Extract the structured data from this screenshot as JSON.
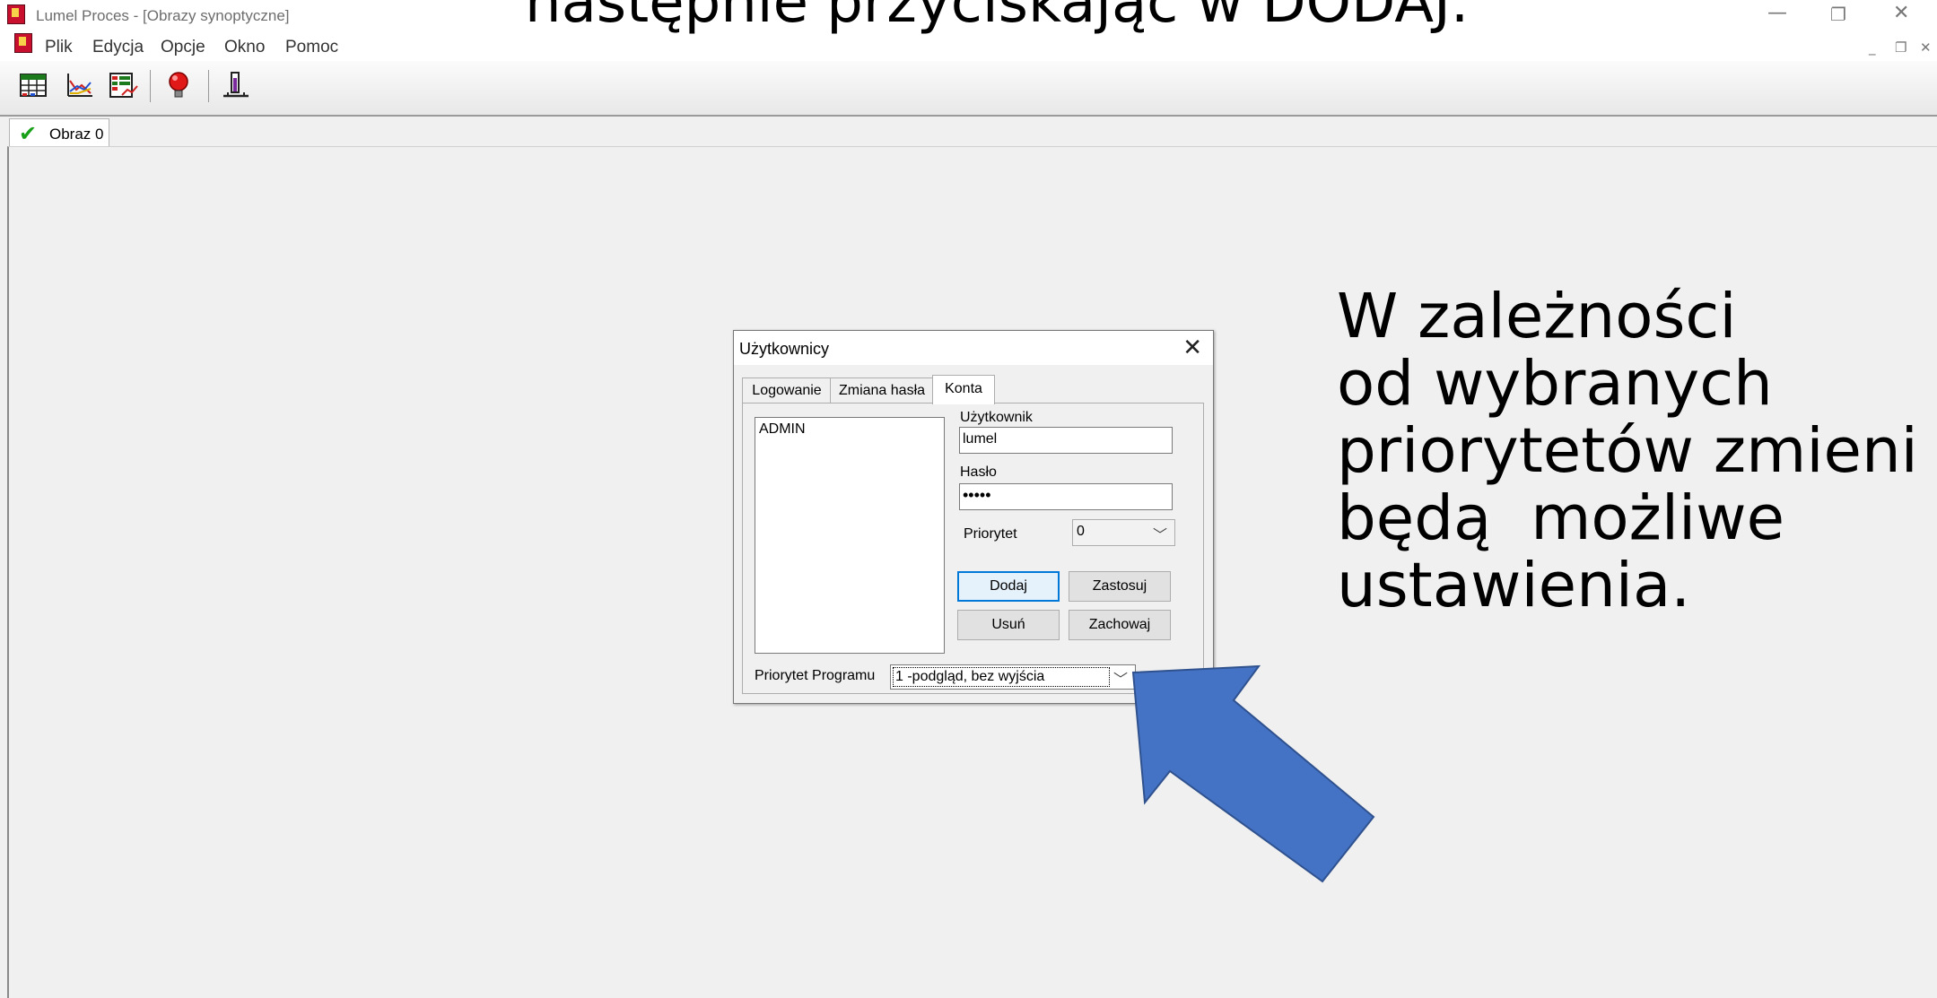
{
  "window": {
    "title": "Lumel Proces - [Obrazy synoptyczne]",
    "controls": {
      "minimize": "—",
      "restore": "❐",
      "close": "✕"
    },
    "mdi_controls": {
      "minimize": "_",
      "restore": "❐",
      "close": "✕"
    }
  },
  "menu": {
    "items": [
      {
        "label": "Plik"
      },
      {
        "label": "Edycja"
      },
      {
        "label": "Opcje"
      },
      {
        "label": "Okno"
      },
      {
        "label": "Pomoc"
      }
    ]
  },
  "toolbar": {
    "buttons": [
      {
        "icon": "table-icon"
      },
      {
        "icon": "line-chart-icon"
      },
      {
        "icon": "list-chart-icon"
      },
      {
        "icon": "alarm-lamp-icon"
      },
      {
        "icon": "level-meter-icon"
      }
    ]
  },
  "doc_tabs": [
    {
      "label": "Obraz 0"
    }
  ],
  "slide": {
    "heading": "następnie przyciskając w DODAJ.",
    "annotation_lines": [
      "W zależności",
      "od wybranych",
      "priorytetów zmieni",
      "będą  możliwe",
      "ustawienia."
    ]
  },
  "dialog": {
    "title": "Użytkownicy",
    "tabs": [
      {
        "label": "Logowanie"
      },
      {
        "label": "Zmiana hasła"
      },
      {
        "label": "Konta"
      }
    ],
    "users": [
      "ADMIN"
    ],
    "username_label": "Użytkownik",
    "username_value": "lumel",
    "password_label": "Hasło",
    "password_value": "•••••",
    "priority_label": "Priorytet",
    "priority_value": "0",
    "buttons": {
      "add": "Dodaj",
      "apply": "Zastosuj",
      "remove": "Usuń",
      "save": "Zachowaj"
    },
    "program_priority_label": "Priorytet Programu",
    "program_priority_value": "1 -podgląd, bez wyjścia"
  },
  "colors": {
    "arrow_fill": "#4472c4",
    "arrow_stroke": "#2f528f",
    "default_button_border": "#0078d7",
    "check_mark": "#18a018"
  }
}
